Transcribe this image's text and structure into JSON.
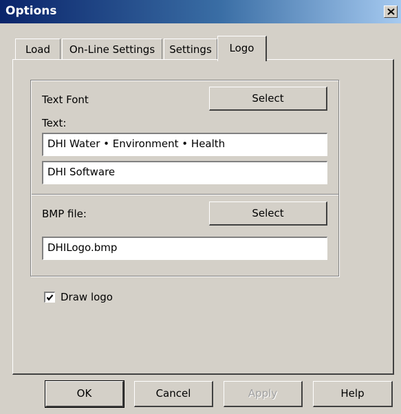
{
  "window": {
    "title": "Options"
  },
  "tabs": [
    {
      "label": "Load"
    },
    {
      "label": "On-Line Settings"
    },
    {
      "label": "Settings"
    },
    {
      "label": "Logo",
      "active": true
    }
  ],
  "logo": {
    "text_font_label": "Text Font",
    "text_font_button": "Select",
    "text_label": "Text:",
    "text_line1": "DHI Water • Environment • Health",
    "text_line2": "DHI Software",
    "bmp_label": "BMP file:",
    "bmp_button": "Select",
    "bmp_value": "DHILogo.bmp",
    "draw_logo_label": "Draw logo",
    "draw_logo_checked": true
  },
  "buttons": {
    "ok": "OK",
    "cancel": "Cancel",
    "apply": "Apply",
    "help": "Help"
  },
  "icons": {
    "close": "close-icon",
    "check": "check-icon"
  }
}
